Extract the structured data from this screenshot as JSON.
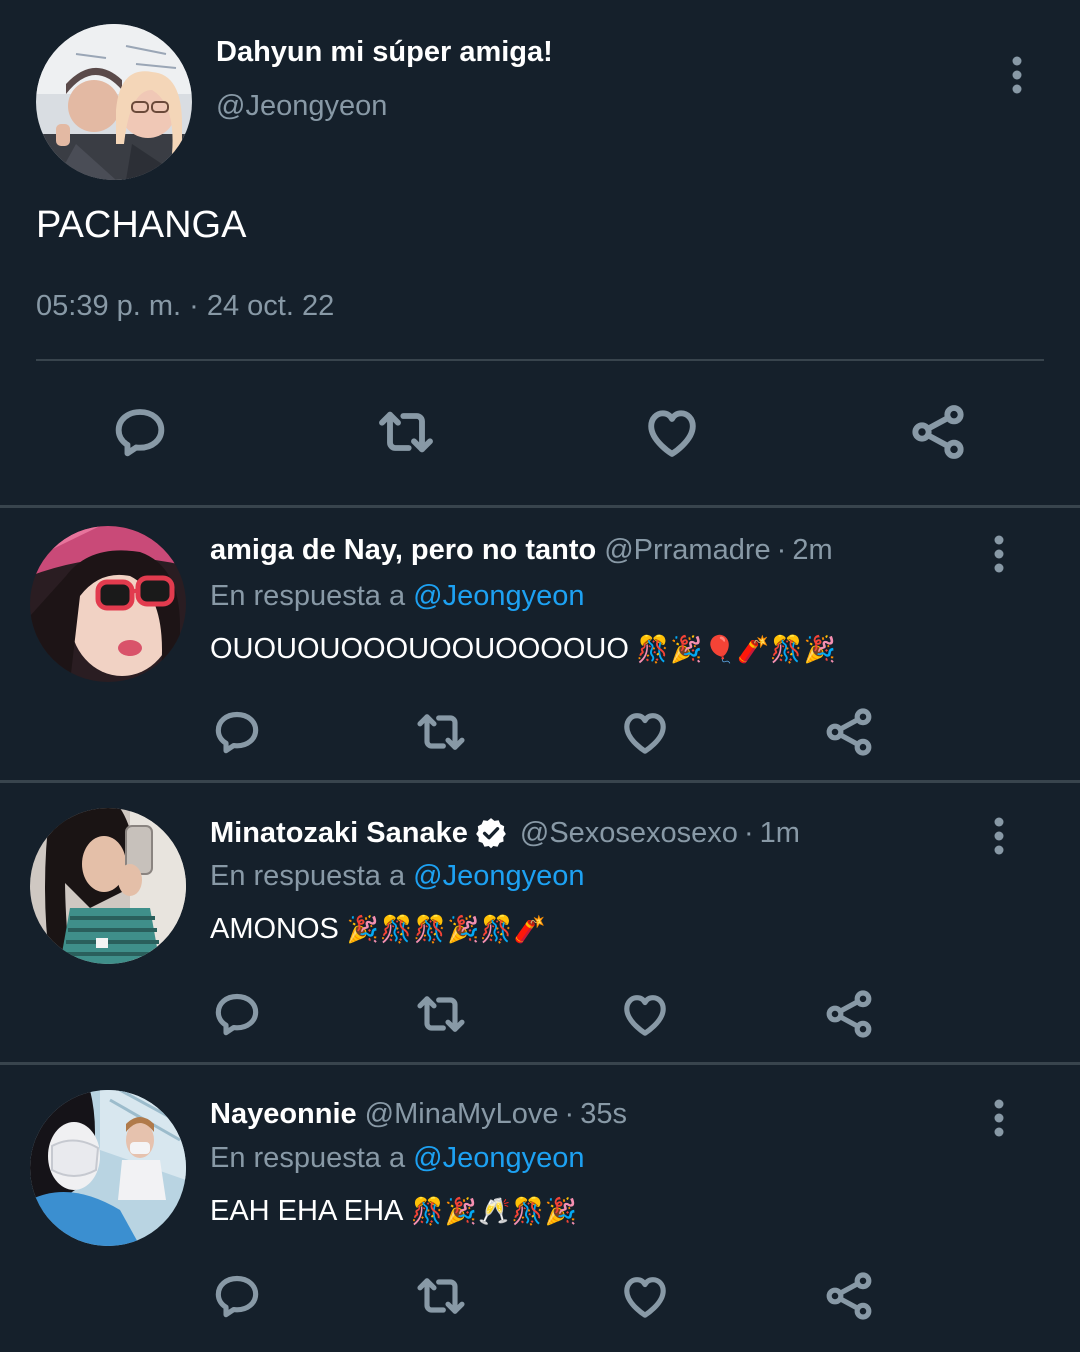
{
  "main_tweet": {
    "display_name": "Dahyun mi súper amiga!",
    "handle": "@Jeongyeon",
    "text": "PACHANGA",
    "timestamp": "05:39 p. m. · 24 oct. 22",
    "more_icon": "more-vertical-icon",
    "actions": [
      "reply-icon",
      "retweet-icon",
      "like-icon",
      "share-icon"
    ]
  },
  "replies": [
    {
      "display_name": "amiga de Nay, pero no tanto",
      "handle": "@Prramadre",
      "dot": "·",
      "time": "2m",
      "verified": false,
      "reply_to_label": "En respuesta a",
      "reply_to_handle": "@Jeongyeon",
      "text": "OUOUOUOOOUOOUOOOOUO",
      "emojis": [
        "🎊",
        "🎉",
        "🎈",
        "🧨",
        "🎊",
        "🎉"
      ]
    },
    {
      "display_name": "Minatozaki Sanake",
      "handle": "@Sexosexosexo",
      "dot": "·",
      "time": "1m",
      "verified": true,
      "reply_to_label": "En respuesta a",
      "reply_to_handle": "@Jeongyeon",
      "text": "AMONOS",
      "emojis": [
        "🎉",
        "🎊",
        "🎊",
        "🎉",
        "🎊",
        "🧨"
      ]
    },
    {
      "display_name": "Nayeonnie",
      "handle": "@MinaMyLove",
      "dot": "·",
      "time": "35s",
      "verified": false,
      "reply_to_label": "En respuesta a",
      "reply_to_handle": "@Jeongyeon",
      "text": "EAH EHA EHA",
      "emojis": [
        "🎊",
        "🎉",
        "🥂",
        "🎊",
        "🎉"
      ]
    }
  ],
  "colors": {
    "background": "#15202b",
    "divider": "#38444d",
    "secondary_text": "#8899a6",
    "accent": "#1da1f2",
    "primary_text": "#ffffff"
  }
}
